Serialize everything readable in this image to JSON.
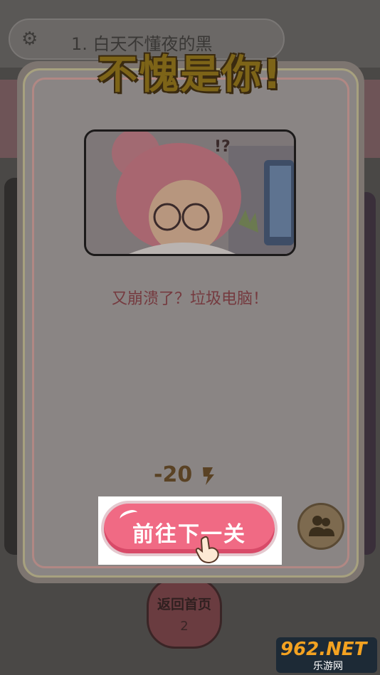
{
  "background": {
    "level_title": "1. 白天不懂夜的黑",
    "home_button_label": "返回首页",
    "home_button_count": "2"
  },
  "dialog": {
    "title": "不愧是你!",
    "caption": "又崩溃了？垃圾电脑！",
    "penalty": "-20",
    "penalty_icon": "lightning-icon",
    "next_button_label": "前往下一关",
    "hand_icon": "pointing-hand-icon",
    "group_icon": "people-icon"
  },
  "watermark": {
    "main": "962.NET",
    "sub": "乐游网"
  },
  "colors": {
    "accent_pink": "#f06a84",
    "title_gold": "#7d6418",
    "caption_red": "#753a3f"
  }
}
